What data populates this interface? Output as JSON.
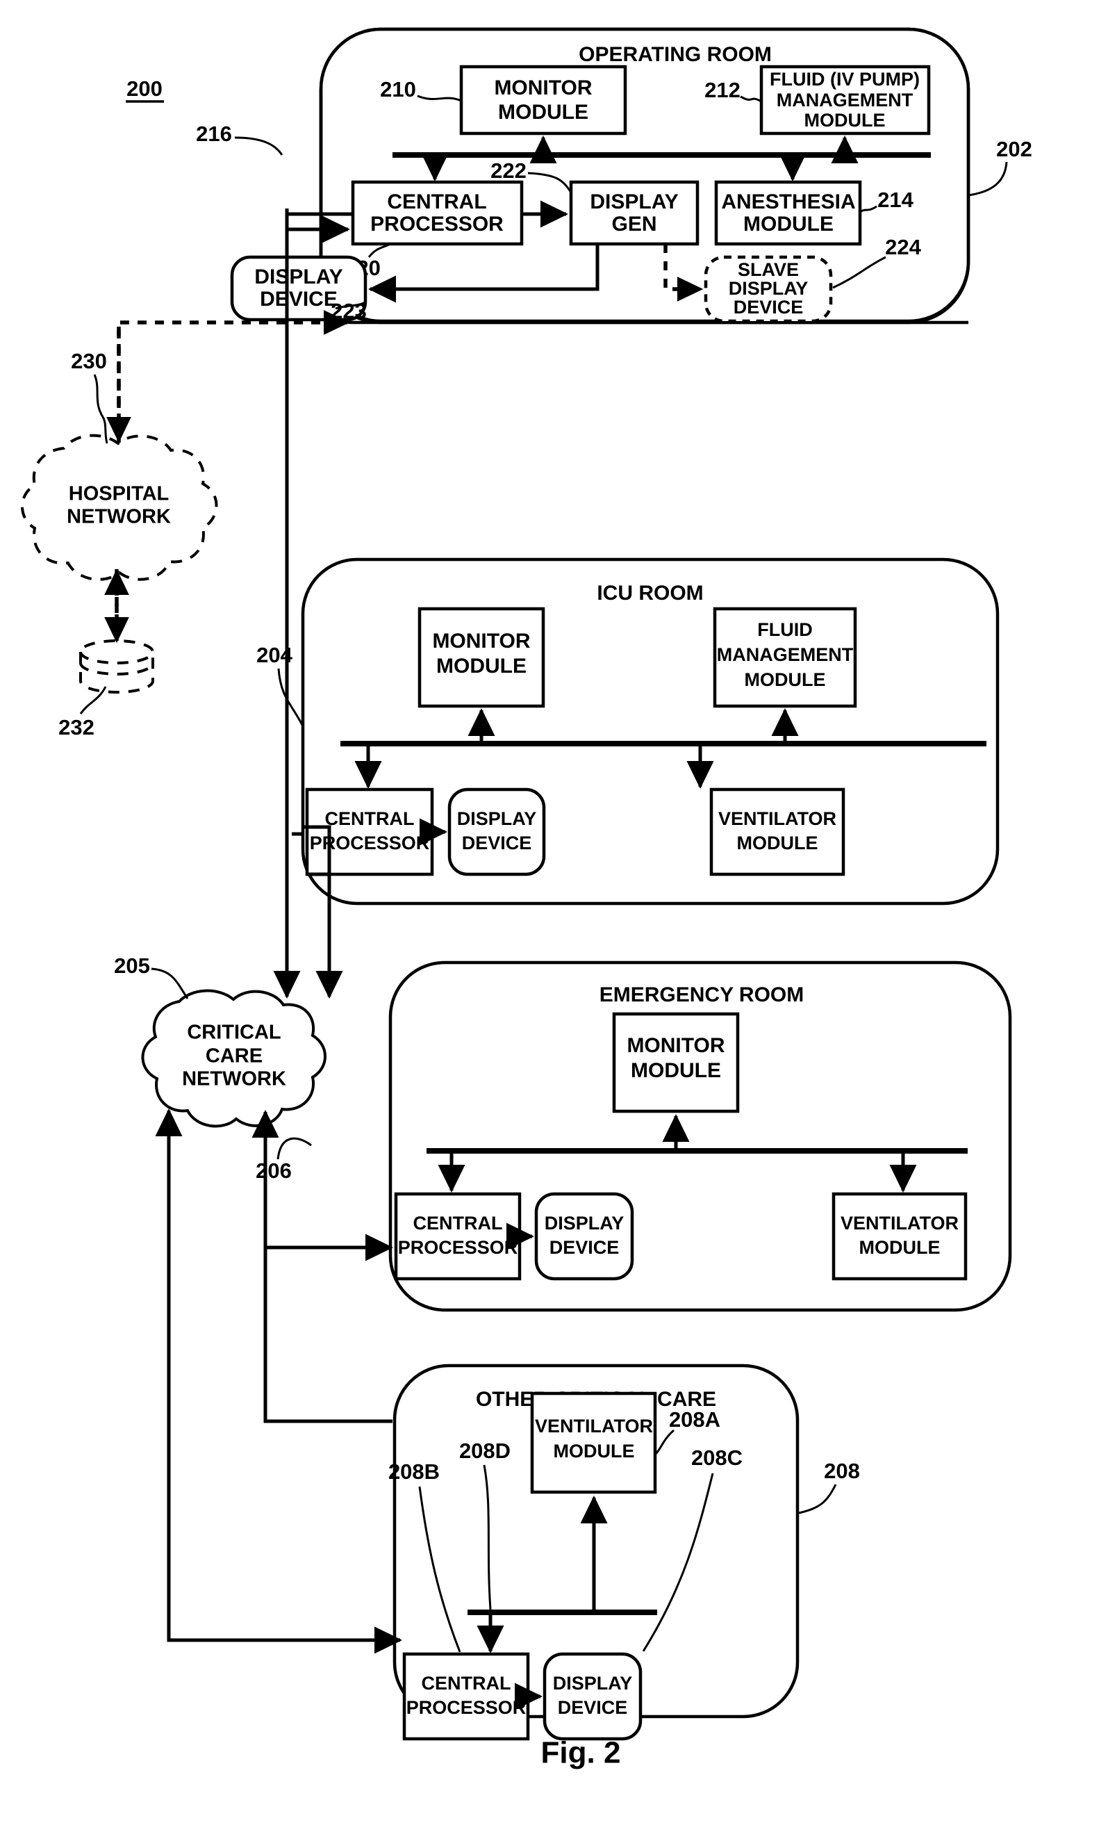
{
  "figure": {
    "caption": "Fig. 2",
    "system_ref": "200"
  },
  "rooms": [
    {
      "id": "operating-room",
      "title": "OPERATING ROOM",
      "ref": "202",
      "modules": [
        {
          "id": "monitor-module",
          "label": "MONITOR MODULE",
          "lines": [
            "MONITOR",
            "MODULE"
          ],
          "ref": "210"
        },
        {
          "id": "fluid-iv-pump-management-module",
          "label": "FLUID (IV PUMP) MANAGEMENT MODULE",
          "lines": [
            "FLUID (IV PUMP)",
            "MANAGEMENT",
            "MODULE"
          ],
          "ref": "212"
        },
        {
          "id": "central-processor",
          "label": "CENTRAL PROCESSOR",
          "lines": [
            "CENTRAL",
            "PROCESSOR"
          ],
          "ref": "220"
        },
        {
          "id": "display-gen",
          "label": "DISPLAY GEN",
          "lines": [
            "DISPLAY",
            "GEN"
          ],
          "ref": "222"
        },
        {
          "id": "anesthesia-module",
          "label": "ANESTHESIA MODULE",
          "lines": [
            "ANESTHESIA",
            "MODULE"
          ],
          "ref": "214"
        },
        {
          "id": "display-device",
          "label": "DISPLAY DEVICE",
          "lines": [
            "DISPLAY",
            "DEVICE"
          ],
          "ref": "223"
        },
        {
          "id": "slave-display-device",
          "label": "SLAVE DISPLAY DEVICE",
          "lines": [
            "SLAVE",
            "DISPLAY",
            "DEVICE"
          ],
          "ref": "224"
        }
      ],
      "bus_ref": "216"
    },
    {
      "id": "icu-room",
      "title": "ICU ROOM",
      "ref": "204",
      "modules": [
        {
          "id": "monitor-module",
          "label": "MONITOR MODULE",
          "lines": [
            "MONITOR",
            "MODULE"
          ],
          "ref": ""
        },
        {
          "id": "fluid-management-module",
          "label": "FLUID MANAGEMENT MODULE",
          "lines": [
            "FLUID",
            "MANAGEMENT",
            "MODULE"
          ],
          "ref": ""
        },
        {
          "id": "central-processor",
          "label": "CENTRAL PROCESSOR",
          "lines": [
            "CENTRAL",
            "PROCESSOR"
          ],
          "ref": ""
        },
        {
          "id": "display-device",
          "label": "DISPLAY DEVICE",
          "lines": [
            "DISPLAY",
            "DEVICE"
          ],
          "ref": ""
        },
        {
          "id": "ventilator-module",
          "label": "VENTILATOR MODULE",
          "lines": [
            "VENTILATOR",
            "MODULE"
          ],
          "ref": ""
        }
      ]
    },
    {
      "id": "emergency-room",
      "title": "EMERGENCY ROOM",
      "ref": "206",
      "modules": [
        {
          "id": "monitor-module",
          "label": "MONITOR MODULE",
          "lines": [
            "MONITOR",
            "MODULE"
          ],
          "ref": ""
        },
        {
          "id": "central-processor",
          "label": "CENTRAL PROCESSOR",
          "lines": [
            "CENTRAL",
            "PROCESSOR"
          ],
          "ref": ""
        },
        {
          "id": "display-device",
          "label": "DISPLAY DEVICE",
          "lines": [
            "DISPLAY",
            "DEVICE"
          ],
          "ref": ""
        },
        {
          "id": "ventilator-module",
          "label": "VENTILATOR MODULE",
          "lines": [
            "VENTILATOR",
            "MODULE"
          ],
          "ref": ""
        }
      ]
    },
    {
      "id": "other-critical-care",
      "title": "OTHER CRITICAL CARE",
      "ref": "208",
      "modules": [
        {
          "id": "ventilator-module",
          "label": "VENTILATOR MODULE",
          "lines": [
            "VENTILATOR",
            "MODULE"
          ],
          "ref": "208A"
        },
        {
          "id": "central-processor",
          "label": "CENTRAL PROCESSOR",
          "lines": [
            "CENTRAL",
            "PROCESSOR"
          ],
          "ref": "208B"
        },
        {
          "id": "display-device",
          "label": "DISPLAY DEVICE",
          "lines": [
            "DISPLAY",
            "DEVICE"
          ],
          "ref": "208C"
        }
      ],
      "bus_ref": "208D"
    }
  ],
  "networks": [
    {
      "id": "hospital-network",
      "lines": [
        "HOSPITAL",
        "NETWORK"
      ],
      "label": "HOSPITAL NETWORK",
      "ref": "230",
      "style": "dashed"
    },
    {
      "id": "critical-care-network",
      "lines": [
        "CRITICAL",
        "CARE",
        "NETWORK"
      ],
      "label": "CRITICAL CARE NETWORK",
      "ref": "205",
      "style": "solid"
    }
  ],
  "storage": {
    "id": "database",
    "ref": "232",
    "label": ""
  },
  "labels": {
    "or_title": "OPERATING ROOM",
    "icu_title": "ICU ROOM",
    "er_title": "EMERGENCY ROOM",
    "occ_title": "OTHER CRITICAL CARE",
    "monitor_1": "MONITOR",
    "module_w": "MODULE",
    "fluid_iv_1": "FLUID (IV PUMP)",
    "management": "MANAGEMENT",
    "fluid": "FLUID",
    "central": "CENTRAL",
    "processor": "PROCESSOR",
    "display": "DISPLAY",
    "gen": "GEN",
    "device": "DEVICE",
    "anesthesia": "ANESTHESIA",
    "slave": "SLAVE",
    "ventilator": "VENTILATOR",
    "hospital": "HOSPITAL",
    "network": "NETWORK",
    "critical": "CRITICAL",
    "care": "CARE",
    "ref_200": "200",
    "ref_202": "202",
    "ref_204": "204",
    "ref_205": "205",
    "ref_206": "206",
    "ref_208": "208",
    "ref_208A": "208A",
    "ref_208B": "208B",
    "ref_208C": "208C",
    "ref_208D": "208D",
    "ref_210": "210",
    "ref_212": "212",
    "ref_214": "214",
    "ref_216": "216",
    "ref_220": "220",
    "ref_222": "222",
    "ref_223": "223",
    "ref_224": "224",
    "ref_230": "230",
    "ref_232": "232",
    "fig_caption": "Fig. 2"
  },
  "colors": {
    "ink": "#000000",
    "paper": "#ffffff"
  }
}
